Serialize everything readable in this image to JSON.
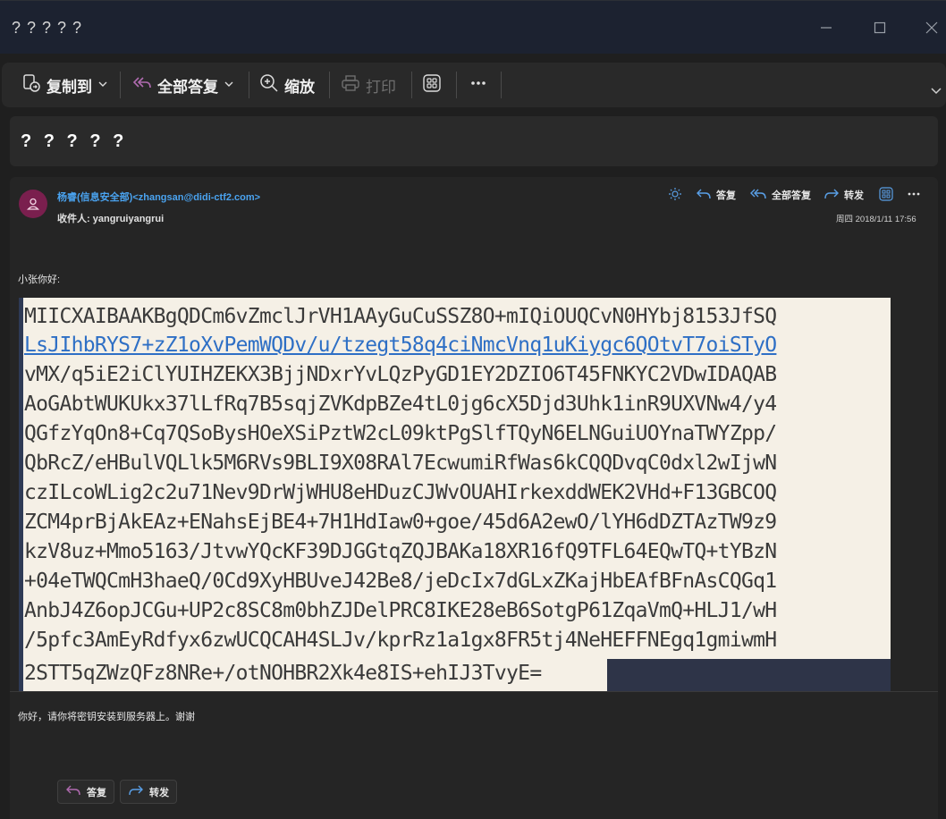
{
  "window": {
    "title": "? ? ? ? ?"
  },
  "ribbon": {
    "copy_label": "复制到",
    "reply_all_label": "全部答复",
    "zoom_label": "缩放",
    "print_label": "打印"
  },
  "message": {
    "subject": "? ? ? ? ?",
    "sender": "杨睿(信息安全部)<zhangsan@didi-ctf2.com>",
    "to_label": "收件人: ",
    "to_value": "yangruiyangrui",
    "date": "周四 2018/1/11 17:56",
    "actions": {
      "reply": "答复",
      "reply_all": "全部答复",
      "forward": "转发"
    },
    "greeting": "小张你好:",
    "key_lines": [
      "MIICXAIBAAKBgQDCm6vZmclJrVH1AAyGuCuSSZ8O+mIQiOUQCvN0HYbj8153JfSQ",
      "LsJIhbRYS7+zZ1oXvPemWQDv/u/tzegt58q4ciNmcVnq1uKiygc6QOtvT7oiSTyO",
      "vMX/q5iE2iClYUIHZEKX3BjjNDxrYvLQzPyGD1EY2DZIO6T45FNKYC2VDwIDAQAB",
      "AoGAbtWUKUkx37lLfRq7B5sqjZVKdpBZe4tL0jg6cX5Djd3Uhk1inR9UXVNw4/y4",
      "QGfzYqOn8+Cq7QSoBysHOeXSiPztW2cL09ktPgSlfTQyN6ELNGuiUOYnaTWYZpp/",
      "QbRcZ/eHBulVQLlk5M6RVs9BLI9X08RAl7EcwumiRfWas6kCQQDvqC0dxl2wIjwN",
      "czILcoWLig2c2u71Nev9DrWjWHU8eHDuzCJWvOUAHIrkexddWEK2VHd+F13GBCOQ",
      "ZCM4prBjAkEAz+ENahsEjBE4+7H1HdIaw0+goe/45d6A2ewO/lYH6dDZTAzTW9z9",
      "kzV8uz+Mmo5163/JtvwYQcKF39DJGGtqZQJBAKa18XR16fQ9TFL64EQwTQ+tYBzN",
      "+04eTWQCmH3haeQ/0Cd9XyHBUveJ42Be8/jeDcIx7dGLxZKajHbEAfBFnAsCQGq1",
      "AnbJ4Z6opJCGu+UP2c8SC8m0bhZJDelPRC8IKE28eB6SotgP61ZqaVmQ+HLJ1/wH",
      "/5pfc3AmEyRdfyx6zwUCQCAH4SLJv/kprRz1a1gx8FR5tj4NeHEFFNEgq1gmiwmH",
      "2STT5qZWzQFz8NRe+/otNOHBR2Xk4e8IS+ehIJ3TvyE="
    ],
    "body": "你好，请你将密钥安装到服务器上。谢谢",
    "footer": {
      "reply": "答复",
      "forward": "转发"
    }
  },
  "colors": {
    "accent_link": "#4aa3f0",
    "avatar": "#7a1f4e",
    "key_bg": "#f5f0e6",
    "reply_icon": "#b06bb0",
    "forward_icon": "#5aa0e8"
  }
}
